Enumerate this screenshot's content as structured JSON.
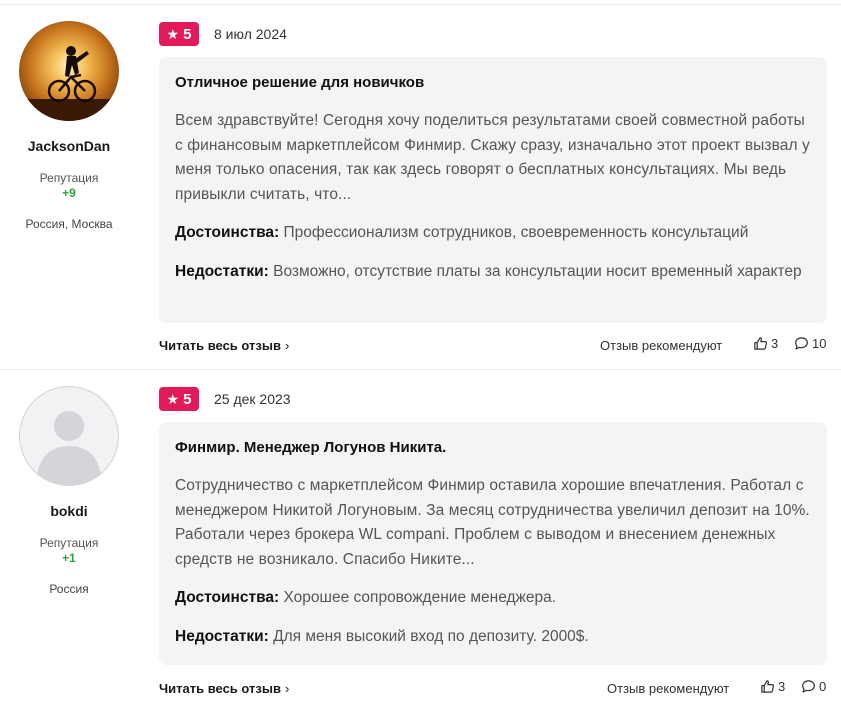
{
  "reviews": [
    {
      "author": "JacksonDan",
      "reputation_label": "Репутация",
      "reputation_value": "+9",
      "location": "Россия, Москва",
      "rating": "5",
      "date": "8 июл 2024",
      "title": "Отличное решение для новичков",
      "body": "Всем здравствуйте! Сегодня хочу поделиться результатами своей совместной работы с финансовым маркетплейсом Финмир. Скажу сразу, изначально этот проект вызвал у меня только опасения, так как здесь говорят о бесплатных консультациях. Мы ведь привыкли считать, что...",
      "pros_label": "Достоинства:",
      "pros": "Профессионализм сотрудников, своевременность консультаций",
      "cons_label": "Недостатки:",
      "cons": "Возможно, отсутствие платы за консультации носит временный характер",
      "read_more": "Читать весь отзыв",
      "recommend_label": "Отзыв рекомендуют",
      "likes": "3",
      "comments": "10"
    },
    {
      "author": "bokdi",
      "reputation_label": "Репутация",
      "reputation_value": "+1",
      "location": "Россия",
      "rating": "5",
      "date": "25 дек 2023",
      "title": "Финмир. Менеджер Логунов Никита.",
      "body": "Сотрудничество с маркетплейсом Финмир оставила хорошие впечатления. Работал с менеджером Никитой Логуновым. За месяц сотрудничества увеличил депозит на 10%. Работали через брокера WL compani. Проблем с выводом и внесением денежных средств не возникало. Спасибо Никите...",
      "pros_label": "Достоинства:",
      "pros": "Хорошее сопровождение менеджера.",
      "cons_label": "Недостатки:",
      "cons": "Для меня высокий вход по депозиту. 2000$.",
      "read_more": "Читать весь отзыв",
      "recommend_label": "Отзыв рекомендуют",
      "likes": "3",
      "comments": "0"
    }
  ],
  "icons": {
    "star": "star-icon",
    "thumb": "thumbs-up-icon",
    "comment": "comment-icon",
    "chevron": "chevron-right-icon"
  },
  "colors": {
    "badge": "#e21a5a",
    "reputation": "#27a53a",
    "card_bg": "#f4f4f6"
  }
}
